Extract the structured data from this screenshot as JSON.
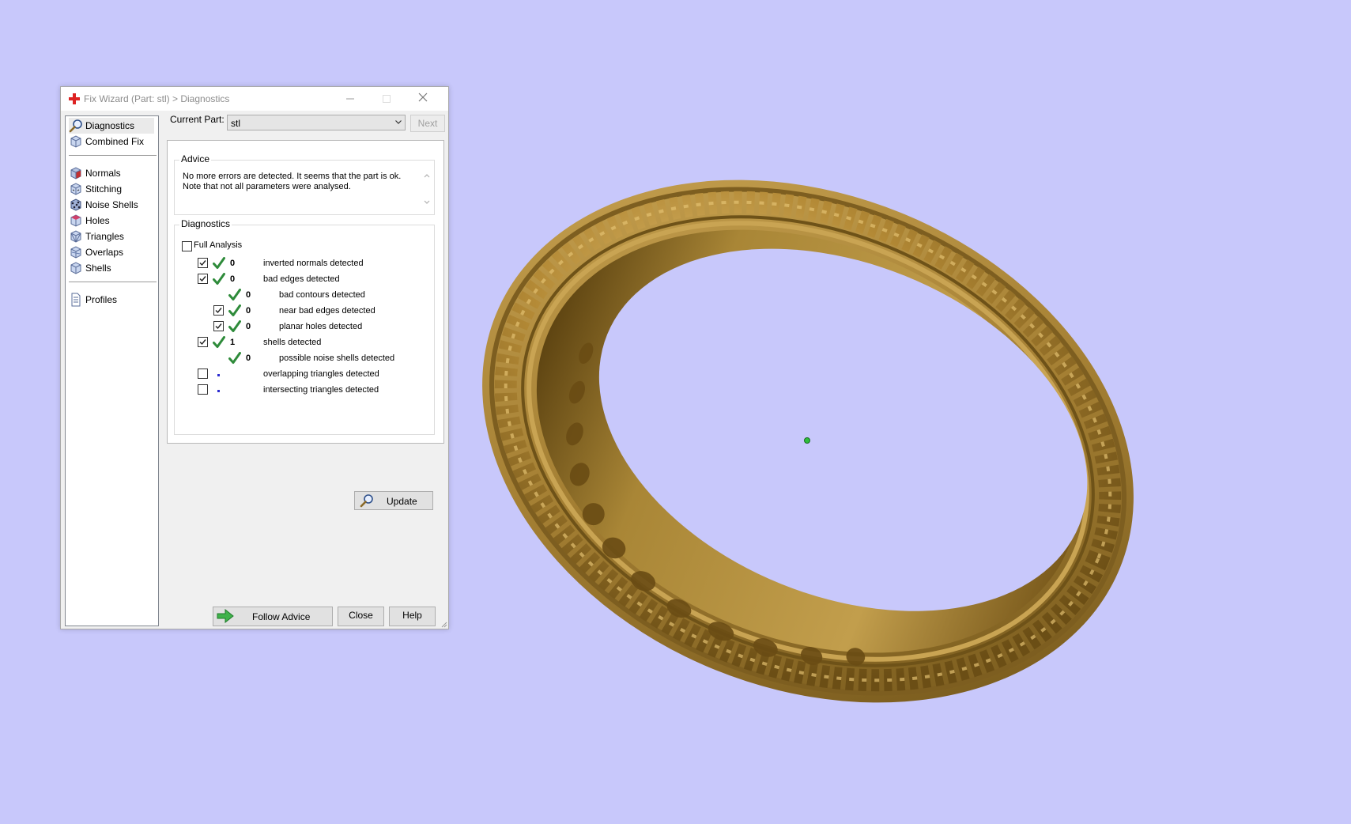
{
  "window": {
    "title": "Fix Wizard (Part: stl) > Diagnostics",
    "controls": [
      "minimize-icon",
      "maximize-icon",
      "close-icon"
    ]
  },
  "nav": {
    "group1": [
      {
        "label": "Diagnostics",
        "icon": "magnifier-icon",
        "selected": true
      },
      {
        "label": "Combined Fix",
        "icon": "cube-icon"
      }
    ],
    "group2": [
      {
        "label": "Normals",
        "icon": "normals-cube-icon"
      },
      {
        "label": "Stitching",
        "icon": "stitching-cube-icon"
      },
      {
        "label": "Noise Shells",
        "icon": "noise-shells-icon"
      },
      {
        "label": "Holes",
        "icon": "holes-cube-icon"
      },
      {
        "label": "Triangles",
        "icon": "triangles-cube-icon"
      },
      {
        "label": "Overlaps",
        "icon": "overlaps-cube-icon"
      },
      {
        "label": "Shells",
        "icon": "shells-cube-icon"
      }
    ],
    "group3": [
      {
        "label": "Profiles",
        "icon": "document-icon"
      }
    ]
  },
  "part": {
    "label": "Current Part:",
    "value": "stl",
    "next_label": "Next"
  },
  "advice": {
    "title": "Advice",
    "text": "No more errors are detected. It seems that the part is ok. Note that not all parameters were analysed."
  },
  "diagnostics": {
    "title": "Diagnostics",
    "full_analysis_label": "Full Analysis",
    "full_analysis_checked": false,
    "rows": [
      {
        "checkbox": true,
        "checked": true,
        "status": "ok",
        "count": "0",
        "label": "inverted normals detected",
        "indent": 0
      },
      {
        "checkbox": true,
        "checked": true,
        "status": "ok",
        "count": "0",
        "label": "bad edges detected",
        "indent": 0
      },
      {
        "checkbox": false,
        "checked": false,
        "status": "ok",
        "count": "0",
        "label": "bad contours detected",
        "indent": 1
      },
      {
        "checkbox": true,
        "checked": true,
        "status": "ok",
        "count": "0",
        "label": "near bad edges detected",
        "indent": 1
      },
      {
        "checkbox": true,
        "checked": true,
        "status": "ok",
        "count": "0",
        "label": "planar holes detected",
        "indent": 1
      },
      {
        "checkbox": true,
        "checked": true,
        "status": "ok",
        "count": "1",
        "label": "shells detected",
        "indent": 0
      },
      {
        "checkbox": false,
        "checked": false,
        "status": "ok",
        "count": "0",
        "label": "possible noise shells detected",
        "indent": 1
      },
      {
        "checkbox": true,
        "checked": false,
        "status": "pending",
        "count": "",
        "label": "overlapping triangles detected",
        "indent": 0
      },
      {
        "checkbox": true,
        "checked": false,
        "status": "pending",
        "count": "",
        "label": "intersecting triangles detected",
        "indent": 0
      }
    ],
    "update_label": "Update"
  },
  "footer": {
    "follow_label": "Follow Advice",
    "close_label": "Close",
    "help_label": "Help"
  },
  "colors": {
    "background": "#c8c8fb",
    "ring_gold": "#a88538",
    "check_green": "#2e8b3a",
    "pending_dot": "#2b2bd0"
  },
  "viewport": {
    "model": "jewelry ring",
    "pivot_marker": "green-dot"
  }
}
